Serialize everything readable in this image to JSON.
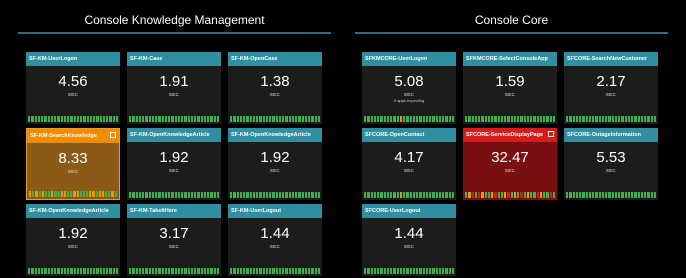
{
  "sections": [
    {
      "title": "Console Knowledge Management"
    },
    {
      "title": "Console Core"
    }
  ],
  "tiles": [
    {
      "header": "SF-KM-UserLogon",
      "value": "4.56",
      "unit": "SEC",
      "note": "",
      "spark": "gggggggggggggggggggggggggggg",
      "state": "normal"
    },
    {
      "header": "SF-KM-Case",
      "value": "1.91",
      "unit": "SEC",
      "note": "",
      "spark": "gggggggggggggggggggggggggggg",
      "state": "normal"
    },
    {
      "header": "SF-KM-OpenCase",
      "value": "1.38",
      "unit": "SEC",
      "note": "",
      "spark": "gggggggggggggggggggggggggggg",
      "state": "normal"
    },
    {
      "header": "SF-KM-SearchKnowledge",
      "value": "8.33",
      "unit": "SEC",
      "note": "",
      "spark": "ygygyggyggyyggyygggyygyyggyg",
      "state": "warn"
    },
    {
      "header": "SF-KM-OpenKnowledgeArticle",
      "value": "1.92",
      "unit": "SEC",
      "note": "",
      "spark": "gggggggggggggggggggggggggggg",
      "state": "normal"
    },
    {
      "header": "SF-KM-OpenKnowledgeArticle",
      "value": "1.92",
      "unit": "SEC",
      "note": "",
      "spark": "gggggggggggggggggggggggggggg",
      "state": "normal"
    },
    {
      "header": "SF-KM-OpenKnowledgeArticle",
      "value": "1.92",
      "unit": "SEC",
      "note": "",
      "spark": "gggggggggggggggggggggggggggg",
      "state": "normal"
    },
    {
      "header": "SF-KM-TakeItHere",
      "value": "3.17",
      "unit": "SEC",
      "note": "",
      "spark": "gggggggggggggggggggggggggggg",
      "state": "normal"
    },
    {
      "header": "SF-KM-UserLogout",
      "value": "1.44",
      "unit": "SEC",
      "note": "",
      "spark": "gggggggggggggggggggggggggggg",
      "state": "normal"
    },
    {
      "header": "SFKMCORE-UserLogon",
      "value": "5.08",
      "unit": "SEC",
      "note": "0 apps expecting",
      "spark": "gggggggggggygggggggggggggggg",
      "state": "normal"
    },
    {
      "header": "SFKMCORE-SelectConsoleApp",
      "value": "1.59",
      "unit": "SEC",
      "note": "",
      "spark": "gggggggggggggggggggggggggggg",
      "state": "normal"
    },
    {
      "header": "SFCORE-SearchNewCustomer",
      "value": "2.17",
      "unit": "SEC",
      "note": "",
      "spark": "gggggggggggggggggggggggggggg",
      "state": "normal"
    },
    {
      "header": "SFCORE-OpenContact",
      "value": "4.17",
      "unit": "SEC",
      "note": "",
      "spark": "gggggggggggygggggggggggggggg",
      "state": "normal"
    },
    {
      "header": "SFCORE-ServiceDisplayPage",
      "value": "32.47",
      "unit": "SEC",
      "note": "",
      "spark": "gyrgryggyrggyrgygrgyggryggrg",
      "state": "alert"
    },
    {
      "header": "SFCORE-OutageInformation",
      "value": "5.53",
      "unit": "SEC",
      "note": "",
      "spark": "gggggggggggggggggggggggggggg",
      "state": "normal"
    },
    {
      "header": "SFCORE-UserLogout",
      "value": "1.44",
      "unit": "SEC",
      "note": "",
      "spark": "gggggggggggggggggggggggggggg",
      "state": "normal"
    }
  ],
  "colors": {
    "background": "#000000",
    "tile_header": "#2f8fa0",
    "warn": "#f08c00",
    "alert": "#d51b1b",
    "spark_green": "#3cb34a",
    "spark_yellow": "#d9a400",
    "spark_red": "#c92020"
  }
}
